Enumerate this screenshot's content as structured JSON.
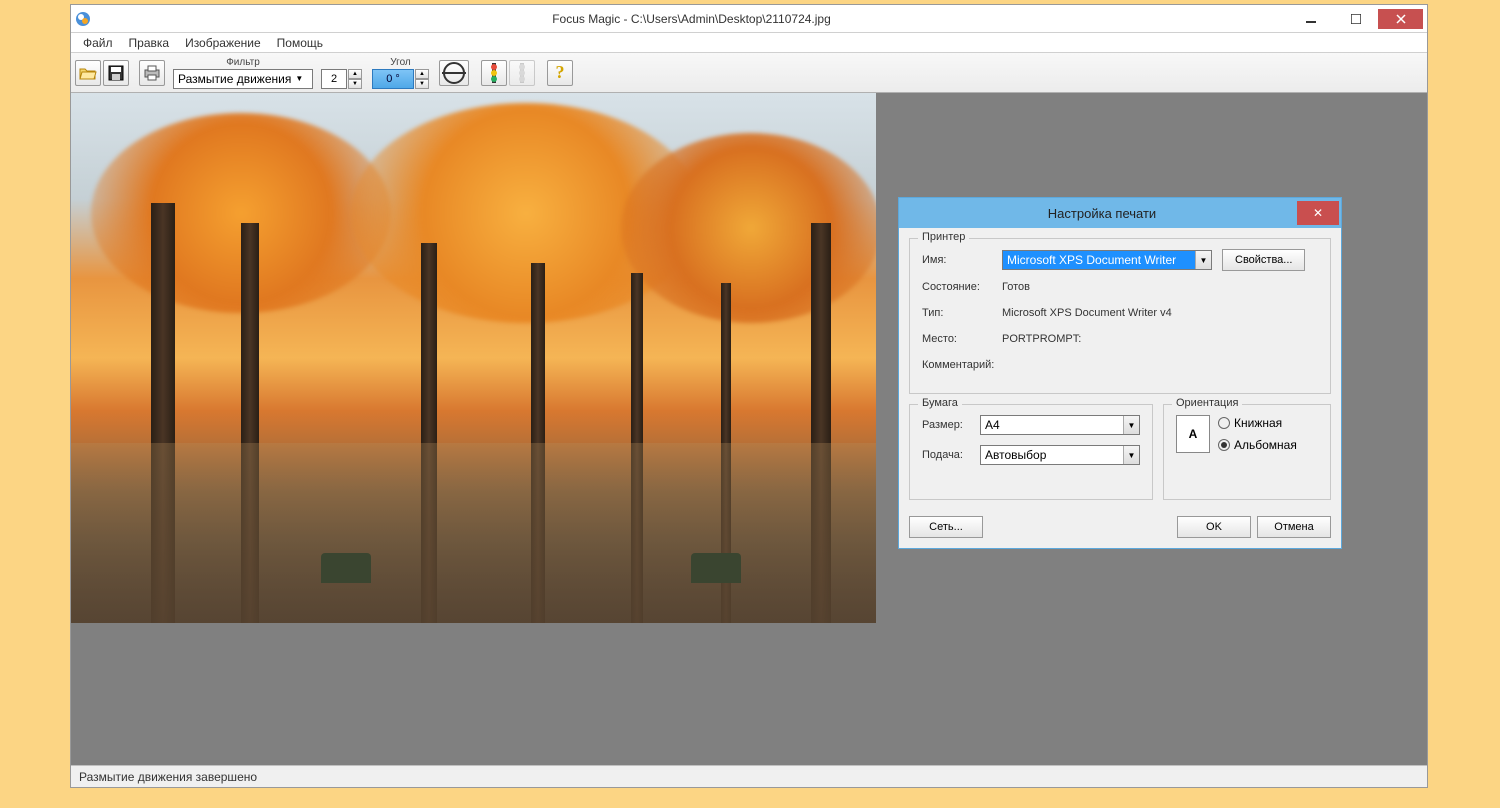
{
  "title": "Focus Magic - C:\\Users\\Admin\\Desktop\\2110724.jpg",
  "menu": {
    "file": "Файл",
    "edit": "Правка",
    "image": "Изображение",
    "help": "Помощь"
  },
  "toolbar": {
    "filter_label": "Фильтр",
    "filter_value": "Размытие движения",
    "amount_value": "2",
    "angle_label": "Угол",
    "angle_value": "0 °"
  },
  "status": "Размытие движения завершено",
  "dialog": {
    "title": "Настройка печати",
    "printer": {
      "legend": "Принтер",
      "name_label": "Имя:",
      "name_value": "Microsoft XPS Document Writer",
      "properties_btn": "Свойства...",
      "status_label": "Состояние:",
      "status_value": "Готов",
      "type_label": "Тип:",
      "type_value": "Microsoft XPS Document Writer v4",
      "location_label": "Место:",
      "location_value": "PORTPROMPT:",
      "comment_label": "Комментарий:",
      "comment_value": ""
    },
    "paper": {
      "legend": "Бумага",
      "size_label": "Размер:",
      "size_value": "A4",
      "source_label": "Подача:",
      "source_value": "Автовыбор"
    },
    "orientation": {
      "legend": "Ориентация",
      "portrait": "Книжная",
      "landscape": "Альбомная",
      "selected": "landscape",
      "icon_letter": "A"
    },
    "network_btn": "Сеть...",
    "ok_btn": "OK",
    "cancel_btn": "Отмена"
  }
}
